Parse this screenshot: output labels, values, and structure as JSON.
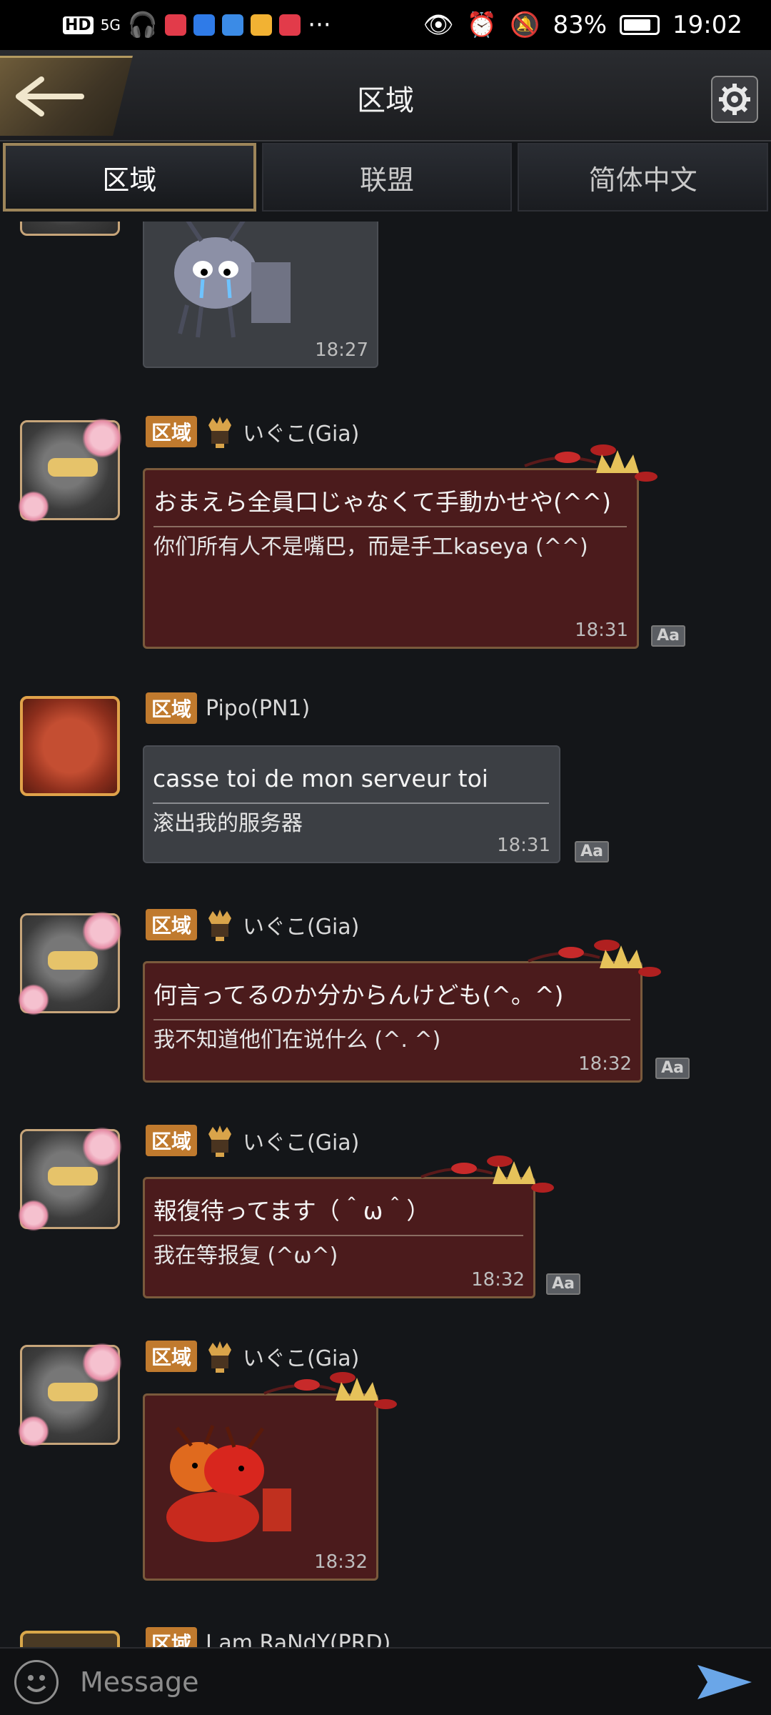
{
  "status_bar": {
    "hd": "HD",
    "signal": "5G",
    "more": "···",
    "battery": "83%",
    "battery_level": 0.83,
    "time": "19:02"
  },
  "header": {
    "title": "区域"
  },
  "tabs": [
    {
      "label": "区域",
      "active": true
    },
    {
      "label": "联盟",
      "active": false
    },
    {
      "label": "简体中文",
      "active": false
    }
  ],
  "messages": [
    {
      "type": "sticker",
      "time": "18:27",
      "sticker": "crying-ant"
    },
    {
      "type": "text",
      "badge": "区域",
      "user": "いぐこ(Gia)",
      "original": "おまえら全員口じゃなくて手動かせや(^^)",
      "translation": "你们所有人不是嘴巴，而是手工kaseya (^^)",
      "time": "18:31"
    },
    {
      "type": "text",
      "badge": "区域",
      "user": "Pipo(PN1)",
      "original": "casse toi de mon serveur toi",
      "translation": "滚出我的服务器",
      "time": "18:31"
    },
    {
      "type": "text",
      "badge": "区域",
      "user": "いぐこ(Gia)",
      "original": "何言ってるのか分からんけども(^。^)",
      "translation": "我不知道他们在说什么 (^. ^)",
      "time": "18:32"
    },
    {
      "type": "text",
      "badge": "区域",
      "user": "いぐこ(Gia)",
      "original": "報復待ってます（＾ω＾）",
      "translation": "我在等报复 (^ω^)",
      "time": "18:32"
    },
    {
      "type": "sticker",
      "badge": "区域",
      "user": "いぐこ(Gia)",
      "time": "18:32",
      "sticker": "hugging-ants"
    },
    {
      "type": "partial",
      "badge": "区域",
      "user": "I am RaNdY(PRD)"
    }
  ],
  "translate_label": "Aa",
  "input": {
    "placeholder": "Message"
  }
}
